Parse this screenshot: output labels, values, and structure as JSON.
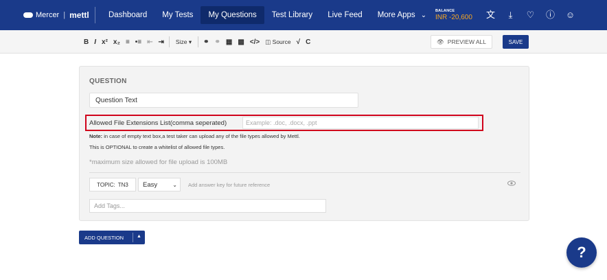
{
  "brand": {
    "company": "Mercer",
    "product": "mettl"
  },
  "nav": {
    "items": [
      {
        "label": "Dashboard",
        "active": false
      },
      {
        "label": "My Tests",
        "active": false
      },
      {
        "label": "My Questions",
        "active": true
      },
      {
        "label": "Test Library",
        "active": false
      },
      {
        "label": "Live Feed",
        "active": false
      },
      {
        "label": "More Apps",
        "active": false
      }
    ]
  },
  "balance": {
    "label": "BALANCE",
    "amount": "INR -20,600"
  },
  "top_icons": [
    "translate-icon",
    "download-icon",
    "bell-icon",
    "help-circle-icon",
    "user-icon"
  ],
  "toolbar": {
    "bold": "B",
    "italic": "I",
    "superscript": "x²",
    "subscript": "x₂",
    "size_label": "Size",
    "source_label": "Source",
    "preview_label": "PREVIEW ALL",
    "save_label": "SAVE"
  },
  "question": {
    "section_label": "QUESTION",
    "text": "Question Text",
    "extensions_label": "Allowed File Extensions List(comma seperated)",
    "extensions_placeholder": "Example: .doc, .docx, .ppt",
    "note_prefix": "Note:",
    "note_line1": " in case of empty text box,a test taker can upload any of the file types allowed by Mettl.",
    "note_line2": "This is OPTIONAL to create a whitelist of allowed file types.",
    "max_size": "*maximum size allowed for file upload is 100MB",
    "topic_label": "TOPIC:",
    "topic_value": "TN3",
    "difficulty": "Easy",
    "answer_key_hint": "Add answer key for future reference",
    "tags_placeholder": "Add Tags..."
  },
  "add_question_label": "ADD QUESTION",
  "help_label": "?",
  "colors": {
    "primary": "#1a3a8a",
    "highlight": "#d0021b",
    "balance": "#f5a623"
  }
}
